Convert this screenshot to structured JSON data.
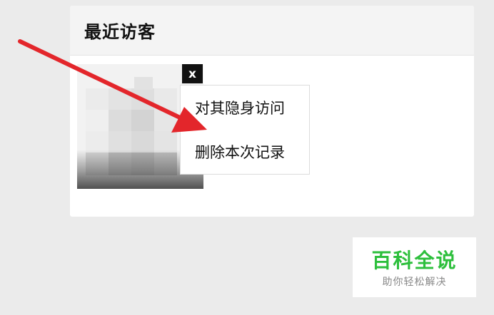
{
  "panel": {
    "title": "最近访客"
  },
  "visitor": {
    "close_label": "x"
  },
  "context_menu": {
    "items": [
      {
        "label": "对其隐身访问"
      },
      {
        "label": "删除本次记录"
      }
    ]
  },
  "annotation": {
    "arrow_color": "#e3262b"
  },
  "watermark": {
    "title": "百科全说",
    "subtitle": "助你轻松解决",
    "title_color": "#2dbf3c"
  }
}
